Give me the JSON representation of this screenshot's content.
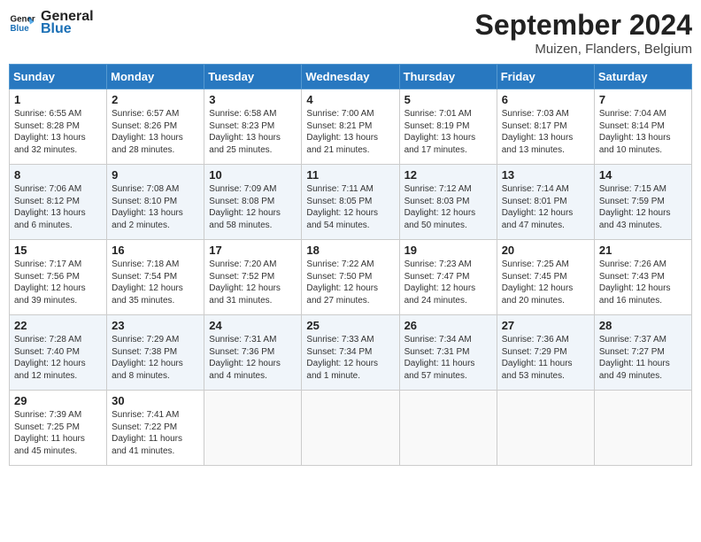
{
  "header": {
    "logo_text_general": "General",
    "logo_text_blue": "Blue",
    "month_title": "September 2024",
    "location": "Muizen, Flanders, Belgium"
  },
  "weekdays": [
    "Sunday",
    "Monday",
    "Tuesday",
    "Wednesday",
    "Thursday",
    "Friday",
    "Saturday"
  ],
  "weeks": [
    [
      {
        "day": "1",
        "sunrise": "Sunrise: 6:55 AM",
        "sunset": "Sunset: 8:28 PM",
        "daylight": "Daylight: 13 hours and 32 minutes."
      },
      {
        "day": "2",
        "sunrise": "Sunrise: 6:57 AM",
        "sunset": "Sunset: 8:26 PM",
        "daylight": "Daylight: 13 hours and 28 minutes."
      },
      {
        "day": "3",
        "sunrise": "Sunrise: 6:58 AM",
        "sunset": "Sunset: 8:23 PM",
        "daylight": "Daylight: 13 hours and 25 minutes."
      },
      {
        "day": "4",
        "sunrise": "Sunrise: 7:00 AM",
        "sunset": "Sunset: 8:21 PM",
        "daylight": "Daylight: 13 hours and 21 minutes."
      },
      {
        "day": "5",
        "sunrise": "Sunrise: 7:01 AM",
        "sunset": "Sunset: 8:19 PM",
        "daylight": "Daylight: 13 hours and 17 minutes."
      },
      {
        "day": "6",
        "sunrise": "Sunrise: 7:03 AM",
        "sunset": "Sunset: 8:17 PM",
        "daylight": "Daylight: 13 hours and 13 minutes."
      },
      {
        "day": "7",
        "sunrise": "Sunrise: 7:04 AM",
        "sunset": "Sunset: 8:14 PM",
        "daylight": "Daylight: 13 hours and 10 minutes."
      }
    ],
    [
      {
        "day": "8",
        "sunrise": "Sunrise: 7:06 AM",
        "sunset": "Sunset: 8:12 PM",
        "daylight": "Daylight: 13 hours and 6 minutes."
      },
      {
        "day": "9",
        "sunrise": "Sunrise: 7:08 AM",
        "sunset": "Sunset: 8:10 PM",
        "daylight": "Daylight: 13 hours and 2 minutes."
      },
      {
        "day": "10",
        "sunrise": "Sunrise: 7:09 AM",
        "sunset": "Sunset: 8:08 PM",
        "daylight": "Daylight: 12 hours and 58 minutes."
      },
      {
        "day": "11",
        "sunrise": "Sunrise: 7:11 AM",
        "sunset": "Sunset: 8:05 PM",
        "daylight": "Daylight: 12 hours and 54 minutes."
      },
      {
        "day": "12",
        "sunrise": "Sunrise: 7:12 AM",
        "sunset": "Sunset: 8:03 PM",
        "daylight": "Daylight: 12 hours and 50 minutes."
      },
      {
        "day": "13",
        "sunrise": "Sunrise: 7:14 AM",
        "sunset": "Sunset: 8:01 PM",
        "daylight": "Daylight: 12 hours and 47 minutes."
      },
      {
        "day": "14",
        "sunrise": "Sunrise: 7:15 AM",
        "sunset": "Sunset: 7:59 PM",
        "daylight": "Daylight: 12 hours and 43 minutes."
      }
    ],
    [
      {
        "day": "15",
        "sunrise": "Sunrise: 7:17 AM",
        "sunset": "Sunset: 7:56 PM",
        "daylight": "Daylight: 12 hours and 39 minutes."
      },
      {
        "day": "16",
        "sunrise": "Sunrise: 7:18 AM",
        "sunset": "Sunset: 7:54 PM",
        "daylight": "Daylight: 12 hours and 35 minutes."
      },
      {
        "day": "17",
        "sunrise": "Sunrise: 7:20 AM",
        "sunset": "Sunset: 7:52 PM",
        "daylight": "Daylight: 12 hours and 31 minutes."
      },
      {
        "day": "18",
        "sunrise": "Sunrise: 7:22 AM",
        "sunset": "Sunset: 7:50 PM",
        "daylight": "Daylight: 12 hours and 27 minutes."
      },
      {
        "day": "19",
        "sunrise": "Sunrise: 7:23 AM",
        "sunset": "Sunset: 7:47 PM",
        "daylight": "Daylight: 12 hours and 24 minutes."
      },
      {
        "day": "20",
        "sunrise": "Sunrise: 7:25 AM",
        "sunset": "Sunset: 7:45 PM",
        "daylight": "Daylight: 12 hours and 20 minutes."
      },
      {
        "day": "21",
        "sunrise": "Sunrise: 7:26 AM",
        "sunset": "Sunset: 7:43 PM",
        "daylight": "Daylight: 12 hours and 16 minutes."
      }
    ],
    [
      {
        "day": "22",
        "sunrise": "Sunrise: 7:28 AM",
        "sunset": "Sunset: 7:40 PM",
        "daylight": "Daylight: 12 hours and 12 minutes."
      },
      {
        "day": "23",
        "sunrise": "Sunrise: 7:29 AM",
        "sunset": "Sunset: 7:38 PM",
        "daylight": "Daylight: 12 hours and 8 minutes."
      },
      {
        "day": "24",
        "sunrise": "Sunrise: 7:31 AM",
        "sunset": "Sunset: 7:36 PM",
        "daylight": "Daylight: 12 hours and 4 minutes."
      },
      {
        "day": "25",
        "sunrise": "Sunrise: 7:33 AM",
        "sunset": "Sunset: 7:34 PM",
        "daylight": "Daylight: 12 hours and 1 minute."
      },
      {
        "day": "26",
        "sunrise": "Sunrise: 7:34 AM",
        "sunset": "Sunset: 7:31 PM",
        "daylight": "Daylight: 11 hours and 57 minutes."
      },
      {
        "day": "27",
        "sunrise": "Sunrise: 7:36 AM",
        "sunset": "Sunset: 7:29 PM",
        "daylight": "Daylight: 11 hours and 53 minutes."
      },
      {
        "day": "28",
        "sunrise": "Sunrise: 7:37 AM",
        "sunset": "Sunset: 7:27 PM",
        "daylight": "Daylight: 11 hours and 49 minutes."
      }
    ],
    [
      {
        "day": "29",
        "sunrise": "Sunrise: 7:39 AM",
        "sunset": "Sunset: 7:25 PM",
        "daylight": "Daylight: 11 hours and 45 minutes."
      },
      {
        "day": "30",
        "sunrise": "Sunrise: 7:41 AM",
        "sunset": "Sunset: 7:22 PM",
        "daylight": "Daylight: 11 hours and 41 minutes."
      },
      null,
      null,
      null,
      null,
      null
    ]
  ]
}
